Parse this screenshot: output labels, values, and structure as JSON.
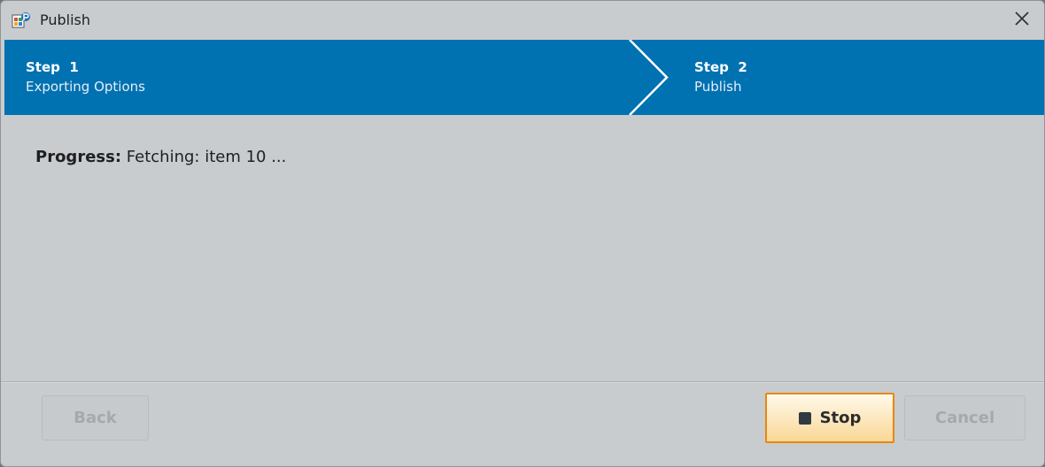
{
  "window": {
    "title": "Publish",
    "app_icon": "publish-app-icon",
    "close_icon": "close-icon"
  },
  "wizard": {
    "steps": [
      {
        "number": "Step  1",
        "label": "Exporting Options",
        "state": "completed"
      },
      {
        "number": "Step  2",
        "label": "Publish",
        "state": "current"
      }
    ],
    "bar_color": "#0071b1"
  },
  "progress": {
    "label": "Progress:",
    "status": "Fetching: item 10 ..."
  },
  "footer": {
    "back_label": "Back",
    "back_enabled": false,
    "stop_label": "Stop",
    "stop_icon": "stop-icon",
    "stop_focused": true,
    "cancel_label": "Cancel",
    "cancel_enabled": false,
    "focus_color": "#e8870e"
  }
}
